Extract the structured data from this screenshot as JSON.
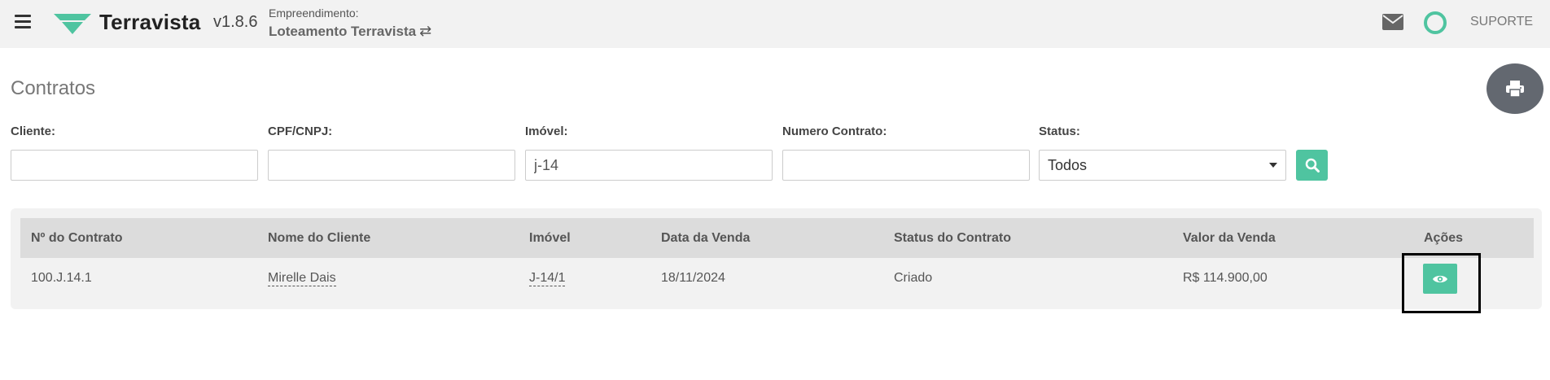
{
  "header": {
    "brand": "Terravista",
    "version": "v1.8.6",
    "empreendimento_label": "Empreendimento:",
    "empreendimento_name": "Loteamento Terravista",
    "swap_glyph": "⇄",
    "support_label": "SUPORTE",
    "brand_color": "#4fc4a0"
  },
  "page": {
    "title": "Contratos"
  },
  "filters": {
    "cliente": {
      "label": "Cliente:",
      "value": "",
      "placeholder": ""
    },
    "cpf": {
      "label": "CPF/CNPJ:",
      "value": "",
      "placeholder": ""
    },
    "imovel": {
      "label": "Imóvel:",
      "value": "j-14",
      "placeholder": ""
    },
    "numero": {
      "label": "Numero Contrato:",
      "value": "",
      "placeholder": ""
    },
    "status": {
      "label": "Status:",
      "selected": "Todos"
    }
  },
  "table": {
    "columns": [
      "Nº do Contrato",
      "Nome do Cliente",
      "Imóvel",
      "Data da Venda",
      "Status do Contrato",
      "Valor da Venda",
      "Ações"
    ],
    "rows": [
      {
        "numero": "100.J.14.1",
        "cliente": "Mirelle Dais",
        "imovel": "J-14/1",
        "data": "18/11/2024",
        "status": "Criado",
        "valor": "R$ 114.900,00"
      }
    ]
  }
}
